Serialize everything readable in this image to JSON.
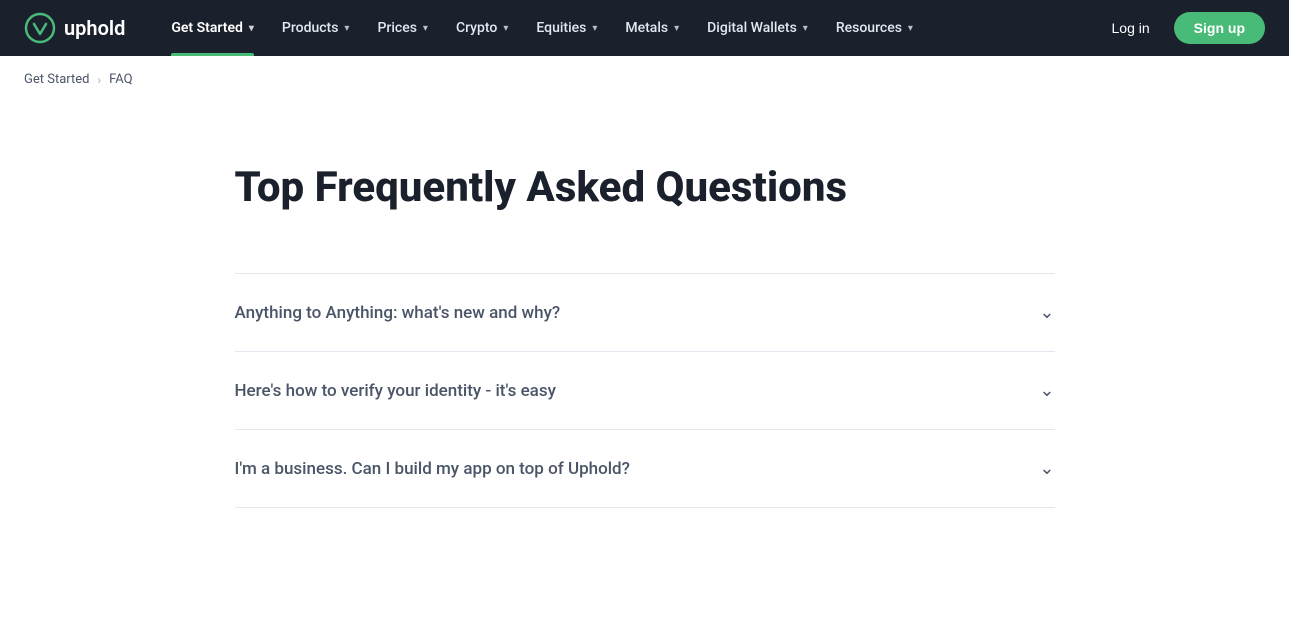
{
  "brand": {
    "logo_text": "uphold",
    "logo_icon": "circle"
  },
  "nav": {
    "items": [
      {
        "label": "Get Started",
        "active": true,
        "has_dropdown": true
      },
      {
        "label": "Products",
        "active": false,
        "has_dropdown": true
      },
      {
        "label": "Prices",
        "active": false,
        "has_dropdown": true
      },
      {
        "label": "Crypto",
        "active": false,
        "has_dropdown": true
      },
      {
        "label": "Equities",
        "active": false,
        "has_dropdown": true
      },
      {
        "label": "Metals",
        "active": false,
        "has_dropdown": true
      },
      {
        "label": "Digital Wallets",
        "active": false,
        "has_dropdown": true
      },
      {
        "label": "Resources",
        "active": false,
        "has_dropdown": true
      }
    ],
    "login_label": "Log in",
    "signup_label": "Sign up"
  },
  "breadcrumb": {
    "parent_label": "Get Started",
    "separator": "›",
    "current_label": "FAQ"
  },
  "main": {
    "page_title": "Top Frequently Asked Questions",
    "faq_items": [
      {
        "question": "Anything to Anything: what's new and why?",
        "expanded": false
      },
      {
        "question": "Here's how to verify your identity - it's easy",
        "expanded": false
      },
      {
        "question": "I'm a business. Can I build my app on top of Uphold?",
        "expanded": false
      }
    ]
  },
  "colors": {
    "nav_bg": "#1a202c",
    "accent_green": "#48bb78",
    "text_dark": "#1a202c",
    "text_muted": "#4a5568",
    "border": "#e2e8f0"
  }
}
